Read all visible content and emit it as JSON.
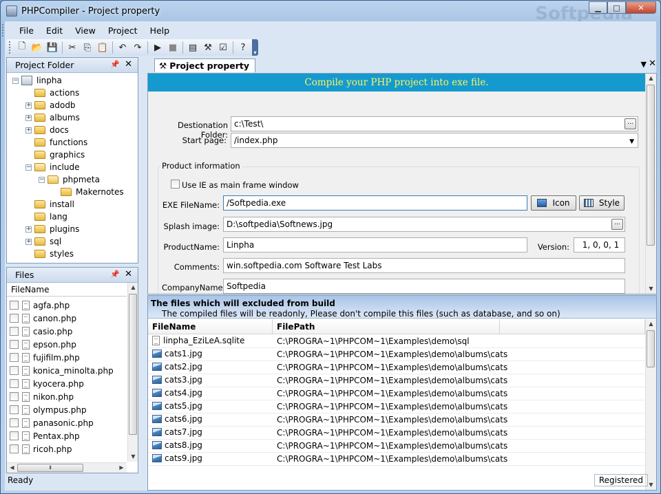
{
  "window": {
    "title": "PHPCompiler - Project property",
    "watermark": "Softpedia"
  },
  "menu": [
    "File",
    "Edit",
    "View",
    "Project",
    "Help"
  ],
  "toolbar_icons": [
    "new-icon",
    "open-icon",
    "save-icon",
    "cut-icon",
    "copy-icon",
    "paste-icon",
    "undo-icon",
    "redo-icon",
    "run-icon",
    "stop-icon",
    "properties-icon",
    "build-icon",
    "checklist-icon",
    "help-icon"
  ],
  "project_panel": {
    "title": "Project Folder",
    "tree": [
      {
        "label": "linpha",
        "level": 0,
        "expander": "-",
        "type": "project"
      },
      {
        "label": "actions",
        "level": 1,
        "expander": "",
        "type": "folder"
      },
      {
        "label": "adodb",
        "level": 1,
        "expander": "+",
        "type": "folder"
      },
      {
        "label": "albums",
        "level": 1,
        "expander": "+",
        "type": "folder"
      },
      {
        "label": "docs",
        "level": 1,
        "expander": "+",
        "type": "folder"
      },
      {
        "label": "functions",
        "level": 1,
        "expander": "",
        "type": "folder"
      },
      {
        "label": "graphics",
        "level": 1,
        "expander": "",
        "type": "folder"
      },
      {
        "label": "include",
        "level": 1,
        "expander": "-",
        "type": "folder-open"
      },
      {
        "label": "phpmeta",
        "level": 2,
        "expander": "-",
        "type": "folder-open"
      },
      {
        "label": "Makernotes",
        "level": 3,
        "expander": "",
        "type": "folder"
      },
      {
        "label": "install",
        "level": 1,
        "expander": "",
        "type": "folder"
      },
      {
        "label": "lang",
        "level": 1,
        "expander": "",
        "type": "folder"
      },
      {
        "label": "plugins",
        "level": 1,
        "expander": "+",
        "type": "folder"
      },
      {
        "label": "sql",
        "level": 1,
        "expander": "+",
        "type": "folder"
      },
      {
        "label": "styles",
        "level": 1,
        "expander": "",
        "type": "folder"
      }
    ]
  },
  "files_panel": {
    "title": "Files",
    "column": "FileName",
    "files": [
      "agfa.php",
      "canon.php",
      "casio.php",
      "epson.php",
      "fujifilm.php",
      "konica_minolta.php",
      "kyocera.php",
      "nikon.php",
      "olympus.php",
      "panasonic.php",
      "Pentax.php",
      "ricoh.php"
    ]
  },
  "tab": {
    "label": "Project property"
  },
  "form": {
    "banner": "Compile your PHP project into exe file.",
    "dest_label": "Destionation Folder:",
    "dest_value": "c:\\Test\\",
    "start_label": "Start page:",
    "start_value": "/index.php",
    "group_title": "Product information",
    "use_ie_label": "Use IE as main frame window",
    "exe_label": "EXE FileName:",
    "exe_value": "/Softpedia.exe",
    "icon_btn": "Icon",
    "style_btn": "Style",
    "splash_label": "Splash image:",
    "splash_value": "D:\\softpedia\\Softnews.jpg",
    "product_label": "ProductName:",
    "product_value": "Linpha",
    "version_label": "Version:",
    "version_value": "1, 0, 0, 1",
    "comments_label": "Comments:",
    "comments_value": "win.softpedia.com Software Test Labs",
    "company_label": "CompanyName:",
    "company_value": "Softpedia",
    "ellipsis": "..."
  },
  "excluded": {
    "title": "The files which will excluded from build",
    "subtitle": "The compiled files will be readonly, Please don't compile this files (such as database, and so on)",
    "columns": [
      "FileName",
      "FilePath"
    ],
    "rows": [
      {
        "name": "linpha_EziLeA.sqlite",
        "path": "C:\\PROGRA~1\\PHPCOM~1\\Examples\\demo\\sql",
        "icon": "file"
      },
      {
        "name": "cats1.jpg",
        "path": "C:\\PROGRA~1\\PHPCOM~1\\Examples\\demo\\albums\\cats",
        "icon": "image"
      },
      {
        "name": "cats2.jpg",
        "path": "C:\\PROGRA~1\\PHPCOM~1\\Examples\\demo\\albums\\cats",
        "icon": "image"
      },
      {
        "name": "cats3.jpg",
        "path": "C:\\PROGRA~1\\PHPCOM~1\\Examples\\demo\\albums\\cats",
        "icon": "image"
      },
      {
        "name": "cats4.jpg",
        "path": "C:\\PROGRA~1\\PHPCOM~1\\Examples\\demo\\albums\\cats",
        "icon": "image"
      },
      {
        "name": "cats5.jpg",
        "path": "C:\\PROGRA~1\\PHPCOM~1\\Examples\\demo\\albums\\cats",
        "icon": "image"
      },
      {
        "name": "cats6.jpg",
        "path": "C:\\PROGRA~1\\PHPCOM~1\\Examples\\demo\\albums\\cats",
        "icon": "image"
      },
      {
        "name": "cats7.jpg",
        "path": "C:\\PROGRA~1\\PHPCOM~1\\Examples\\demo\\albums\\cats",
        "icon": "image"
      },
      {
        "name": "cats8.jpg",
        "path": "C:\\PROGRA~1\\PHPCOM~1\\Examples\\demo\\albums\\cats",
        "icon": "image"
      },
      {
        "name": "cats9.jpg",
        "path": "C:\\PROGRA~1\\PHPCOM~1\\Examples\\demo\\albums\\cats",
        "icon": "image"
      }
    ]
  },
  "status": {
    "left": "Ready",
    "right": "Registered"
  }
}
